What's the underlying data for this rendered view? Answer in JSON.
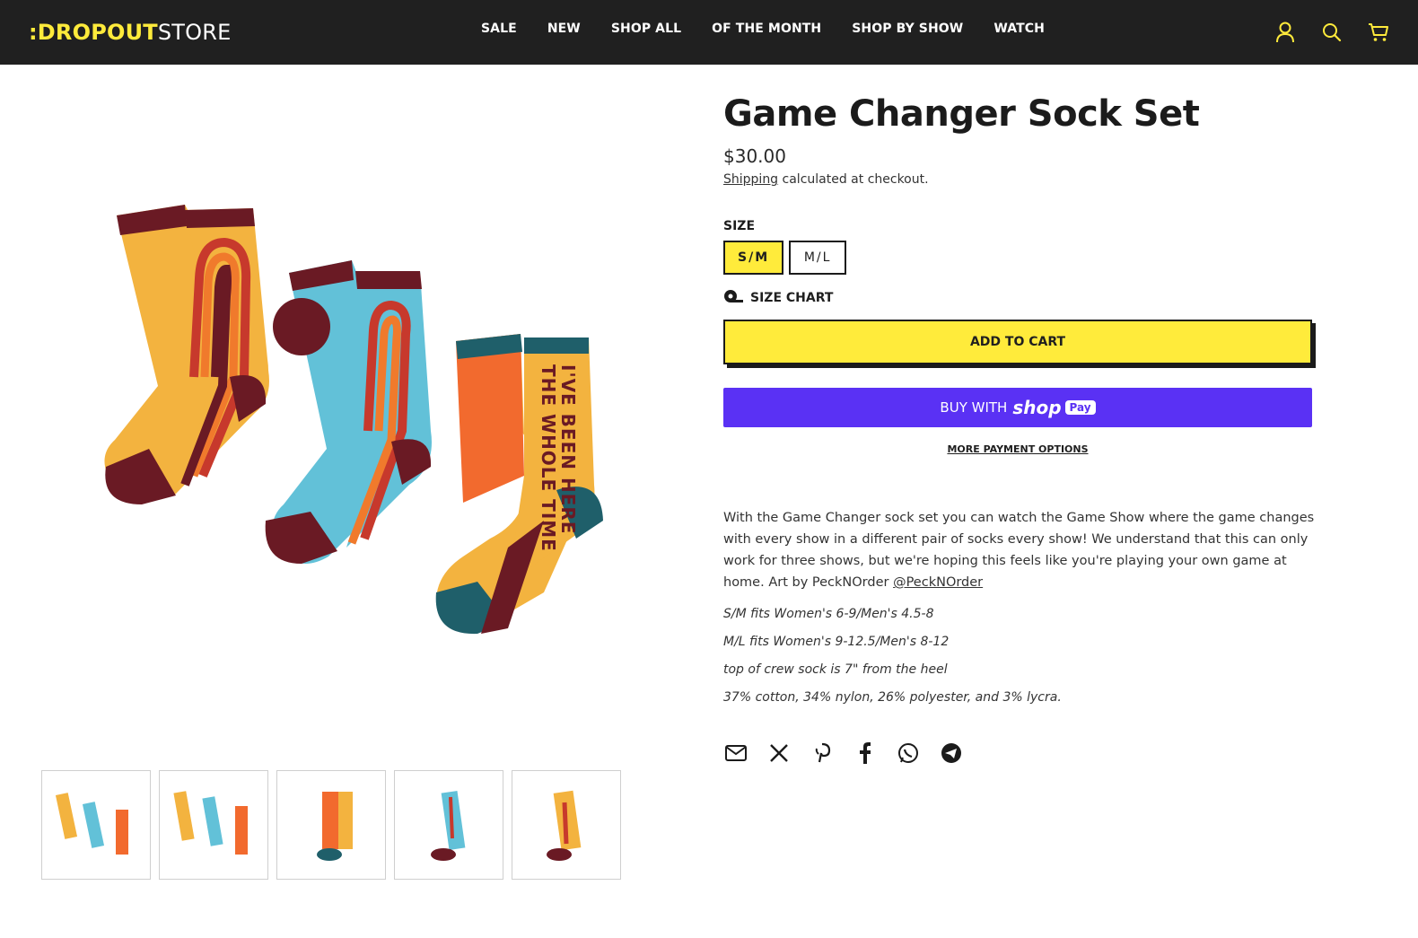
{
  "header": {
    "logo_brand": ":DROPOUT",
    "logo_store": "STORE",
    "nav": [
      "SALE",
      "NEW",
      "SHOP ALL",
      "OF THE MONTH",
      "SHOP BY SHOW",
      "WATCH"
    ],
    "icons": [
      "account-icon",
      "search-icon",
      "cart-icon"
    ]
  },
  "colors": {
    "header_bg": "#202020",
    "accent": "#ffeb3b",
    "shop_pay": "#5a31f4"
  },
  "gallery": {
    "main_image_alt": "Game Changer Sock Set",
    "thumbnail_count": 5
  },
  "product": {
    "title": "Game Changer Sock Set",
    "price": "$30.00",
    "shipping_link": "Shipping",
    "shipping_text": " calculated at checkout.",
    "size_label": "SIZE",
    "sizes": [
      "S/M",
      "M/L"
    ],
    "selected_size": "S/M",
    "size_chart_label": "SIZE CHART",
    "add_to_cart": "ADD TO CART",
    "buy_with": "BUY WITH",
    "shop_word": "shop",
    "pay_word": "Pay",
    "more_payment": "MORE PAYMENT OPTIONS",
    "description": "With the Game Changer sock set you can watch the Game Show where the game changes with every show in a different pair of socks every show! We understand that this can only work for three shows, but we're hoping this feels like you're playing your own game at home. Art by PeckNOrder ",
    "description_link": "@PeckNOrder",
    "fit_sm": "S/M fits Women's 6-9/Men's 4.5-8",
    "fit_ml": "M/L fits Women's 9-12.5/Men's 8-12",
    "crew_note": "top of crew sock is 7\" from the heel",
    "materials": "37% cotton, 34% nylon, 26% polyester, and 3% lycra."
  },
  "share_icons": [
    "email-icon",
    "x-icon",
    "pinterest-icon",
    "facebook-icon",
    "whatsapp-icon",
    "telegram-icon"
  ]
}
